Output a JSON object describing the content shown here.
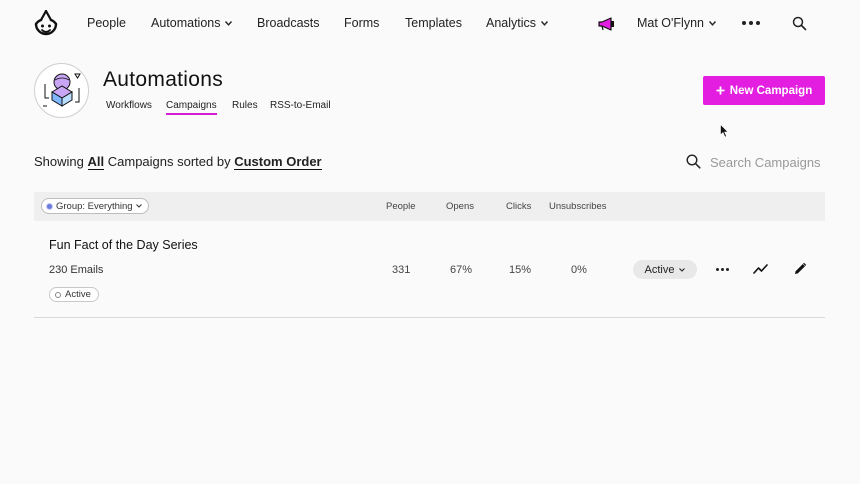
{
  "nav": {
    "items": [
      {
        "label": "People",
        "has_dropdown": false
      },
      {
        "label": "Automations",
        "has_dropdown": true
      },
      {
        "label": "Broadcasts",
        "has_dropdown": false
      },
      {
        "label": "Forms",
        "has_dropdown": false
      },
      {
        "label": "Templates",
        "has_dropdown": false
      },
      {
        "label": "Analytics",
        "has_dropdown": true
      }
    ],
    "user_name": "Mat O'Flynn",
    "icons": [
      "drip-logo-icon",
      "megaphone-icon",
      "more-dots-icon",
      "search-icon"
    ]
  },
  "header": {
    "title": "Automations",
    "tabs": [
      {
        "label": "Workflows",
        "active": false
      },
      {
        "label": "Campaigns",
        "active": true
      },
      {
        "label": "Rules",
        "active": false
      },
      {
        "label": "RSS-to-Email",
        "active": false
      }
    ],
    "new_button_label": "New Campaign"
  },
  "filter": {
    "prefix": "Showing",
    "scope": "All",
    "middle": "Campaigns sorted by",
    "sort": "Custom Order",
    "search_placeholder": "Search Campaigns"
  },
  "table": {
    "group_label": "Group: Everything",
    "columns": [
      "People",
      "Opens",
      "Clicks",
      "Unsubscribes"
    ],
    "rows": [
      {
        "name": "Fun Fact of the Day Series",
        "emails": "230 Emails",
        "badge": "Active",
        "people": "331",
        "opens": "67%",
        "clicks": "15%",
        "unsubscribes": "0%",
        "status": "Active"
      }
    ]
  },
  "colors": {
    "accent": "#e31ee0",
    "tab_underline": "#d61bd4",
    "background": "#fafafa",
    "table_header_bg": "#efefef"
  }
}
